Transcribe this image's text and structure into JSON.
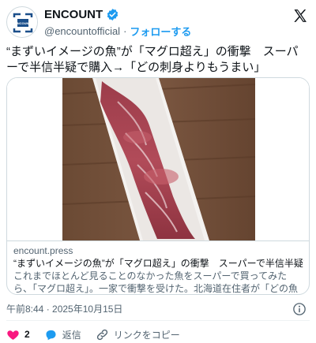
{
  "profile": {
    "display_name": "ENCOUNT",
    "handle": "@encountofficial",
    "separator": "·",
    "follow_label": "フォローする",
    "avatar_text": "ENCOUNT",
    "verified_icon": "verified-badge-icon",
    "brand_color": "#1d9bf0"
  },
  "tweet": {
    "text": "“まずいイメージの魚”が「マグロ超え」の衝撃　スーパーで半信半疑で購入→「どの刺身よりもうまい」"
  },
  "card": {
    "image_alt": "sashimi-photo",
    "domain": "encount.press",
    "title": "“まずいイメージの魚”が「マグロ超え」の衝撃　スーパーで半信半疑で…",
    "description": "これまでほとんど見ることのなかった魚をスーパーで買ってみたら、「マグロ超え」。一家で衝撃を受けた。北海道在住者が「どの魚の刺…"
  },
  "meta": {
    "timestamp": "午前8:44 · 2025年10月15日"
  },
  "actions": {
    "like_count": "2",
    "reply_label": "返信",
    "copy_link_label": "リンクをコピー",
    "like_color": "#f91880"
  }
}
